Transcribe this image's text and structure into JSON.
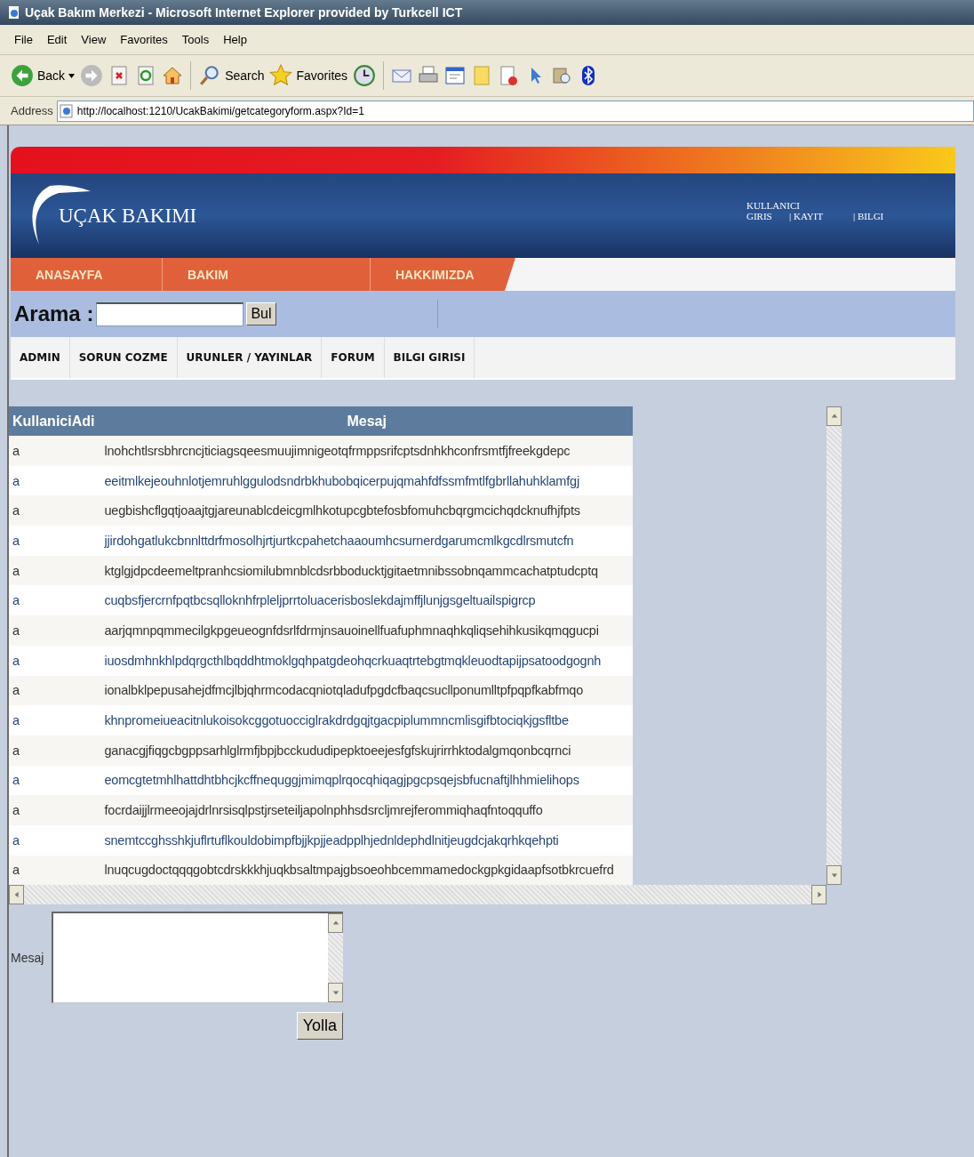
{
  "window": {
    "title": "Uçak Bakım Merkezi - Microsoft Internet Explorer provided by Turkcell ICT"
  },
  "menu": [
    "File",
    "Edit",
    "View",
    "Favorites",
    "Tools",
    "Help"
  ],
  "toolbar": {
    "back": "Back",
    "search": "Search",
    "favorites": "Favorites"
  },
  "address": {
    "label": "Address",
    "url": "http://localhost:1210/UcakBakimi/getcategoryform.aspx?Id=1"
  },
  "header": {
    "logo": "UÇAK BAKIMI",
    "user_label": "KULLANICI",
    "links": [
      "GIRIS",
      "| KAYIT",
      "| BILGI"
    ]
  },
  "nav": [
    "ANASAYFA",
    "BAKIM",
    "HAKKIMIZDA"
  ],
  "search": {
    "label": "Arama :",
    "button": "Bul"
  },
  "submenu": [
    "ADMIN",
    "SORUN COZME",
    "URUNLER / YAYINLAR",
    "FORUM",
    "BILGI GIRISI"
  ],
  "table": {
    "columns": [
      "KullaniciAdi",
      "Mesaj"
    ],
    "rows": [
      [
        "a",
        "lnohchtlsrsbhrcncjticiagsqeesmuujimnigeotqfrmppsrifcptsdnhkhconfrsmtfjfreekgdepc"
      ],
      [
        "a",
        "eeitmlkejeouhnlotjemruhlggulodsndrbkhubobqicerpujqmahfdfssmfmtlfgbrllahuhklamfgj"
      ],
      [
        "a",
        "uegbishcflgqtjoaajtgjareunablcdeicgmlhkotupcgbtefosbfomuhcbqrgmcichqdcknufhjfpts"
      ],
      [
        "a",
        "jjirdohgatlukcbnnlttdrfmosolhjrtjurtkcpahetchaaoumhcsurnerdgarumcmlkgcdlrsmutcfn"
      ],
      [
        "a",
        "ktglgjdpcdeemeltpranhcsiomilubmnblcdsrbboducktjgitaetmnibssobnqammcachatptudcptq"
      ],
      [
        "a",
        "cuqbsfjercrnfpqtbcsqlloknhfrpleljprrtoluacerisboslekdajmffjlunjgsgeltuailspigrcp"
      ],
      [
        "a",
        "aarjqmnpqmmecilgkpgeueognfdsrlfdrmjnsauoinellfuafuphmnaqhkqliqsehihkusikqmqgucpi"
      ],
      [
        "a",
        "iuosdmhnkhlpdqrgcthlbqddhtmoklgqhpatgdeohqcrkuaqtrtebgtmqkleuodtapijpsatoodgognh"
      ],
      [
        "a",
        "ionalbklpepusahejdfmcjlbjqhrmcodacqniotqladufpgdcfbaqcsucllponumlltpfpqpfkabfmqo"
      ],
      [
        "a",
        "khnpromeiueacitnlukoisokcggotuocciglrakdrdgqjtgacpiplummncmlisgifbtociqkjgsfltbe"
      ],
      [
        "a",
        "ganacgjfiqgcbgppsarhlglrmfjbpjbcckududipepktoeejesfgfskujrirrhktodalgmqonbcqrnci"
      ],
      [
        "a",
        "eomcgtetmhlhattdhtbhcjkcffnequggjmimqplrqocqhiqagjpgcpsqejsbfucnaftjlhhmielihops"
      ],
      [
        "a",
        "focrdaijjlrmeeojajdrlnrsisqlpstjrseteiljapolnphhsdsrcljmrejferommiqhaqfntoqquffo"
      ],
      [
        "a",
        "snemtccghsshkjuflrtuflkouldobimpfbjjkpjjeadpplhjednldephdlnitjeugdcjakqrhkqehpti"
      ],
      [
        "a",
        "lnuqcugdoctqqqgobtcdrskkkhjuqkbsaltmpajgbsoeohbcemmamedockgpkgidaapfsotbkrcuefrd"
      ]
    ]
  },
  "form": {
    "label": "Mesaj",
    "button": "Yolla"
  }
}
